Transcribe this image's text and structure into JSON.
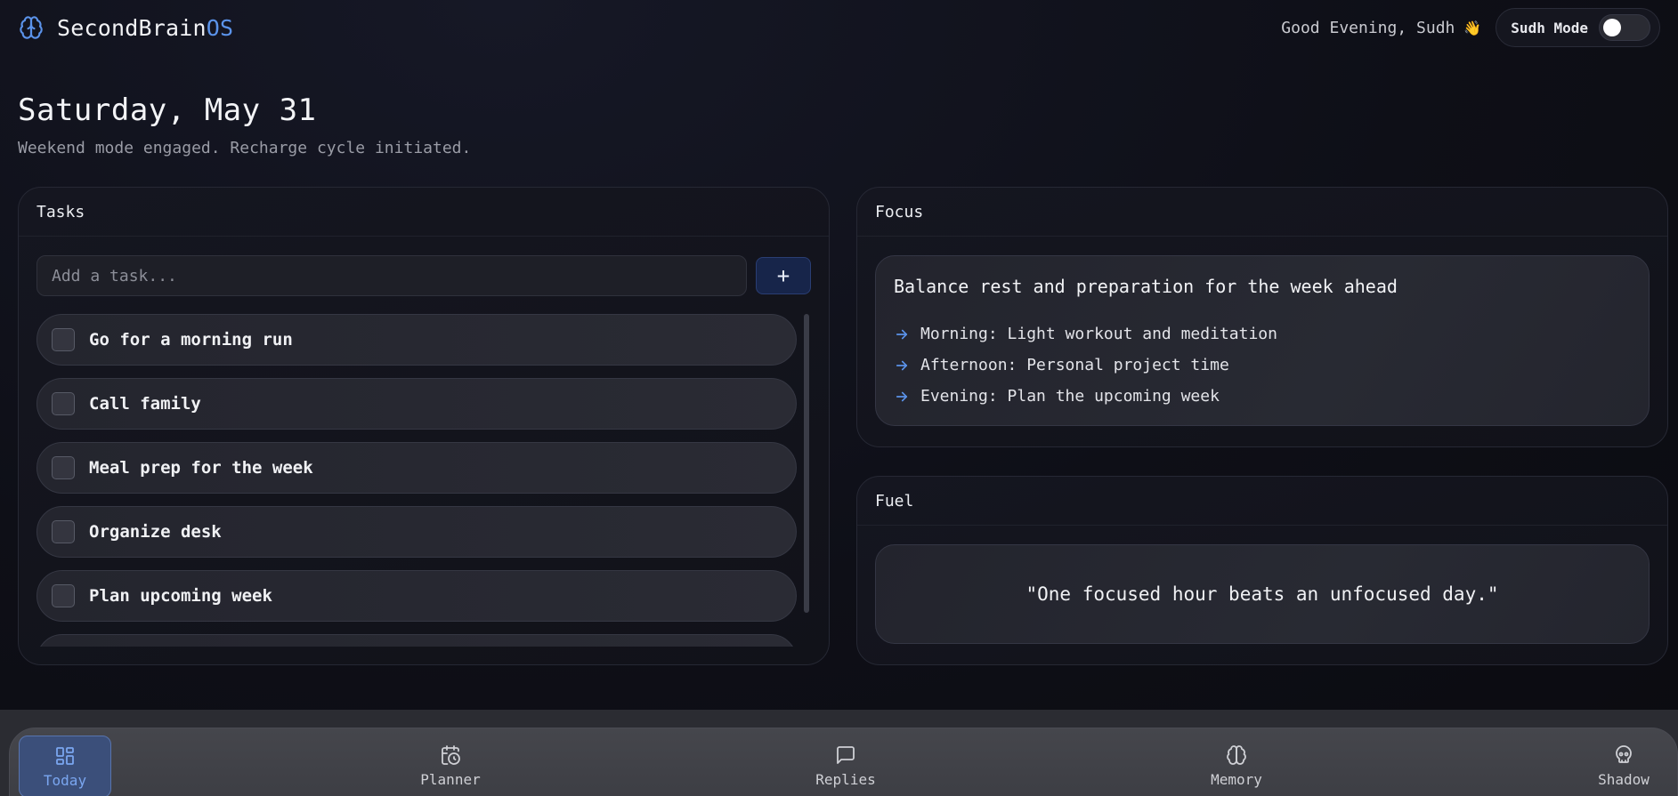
{
  "header": {
    "brand_main": "SecondBrain",
    "brand_accent": "OS",
    "brand_icon": "brain-icon",
    "greeting": "Good Evening, Sudh",
    "greeting_emoji": "👋",
    "mode_label": "Sudh Mode",
    "mode_enabled": false
  },
  "date": {
    "title": "Saturday, May 31",
    "subtitle": "Weekend mode engaged. Recharge cycle initiated."
  },
  "tasks": {
    "heading": "Tasks",
    "input_placeholder": "Add a task...",
    "input_value": "",
    "add_label": "+",
    "items": [
      {
        "label": "Go for a morning run",
        "done": false
      },
      {
        "label": "Call family",
        "done": false
      },
      {
        "label": "Meal prep for the week",
        "done": false
      },
      {
        "label": "Organize desk",
        "done": false
      },
      {
        "label": "Plan upcoming week",
        "done": false
      }
    ]
  },
  "focus": {
    "heading": "Focus",
    "title": "Balance rest and preparation for the week ahead",
    "items": [
      "Morning: Light workout and meditation",
      "Afternoon: Personal project time",
      "Evening: Plan the upcoming week"
    ]
  },
  "fuel": {
    "heading": "Fuel",
    "quote": "\"One focused hour beats an unfocused day.\""
  },
  "nav": {
    "items": [
      {
        "label": "Today",
        "icon": "grid-icon",
        "active": true
      },
      {
        "label": "Planner",
        "icon": "calendar-clock-icon",
        "active": false
      },
      {
        "label": "Replies",
        "icon": "message-icon",
        "active": false
      },
      {
        "label": "Memory",
        "icon": "brain-icon",
        "active": false
      },
      {
        "label": "Shadow",
        "icon": "skull-icon",
        "active": false
      }
    ]
  },
  "colors": {
    "accent": "#5b93ea",
    "background": "#0d0e16",
    "nav_active": "#3b4f7a"
  }
}
